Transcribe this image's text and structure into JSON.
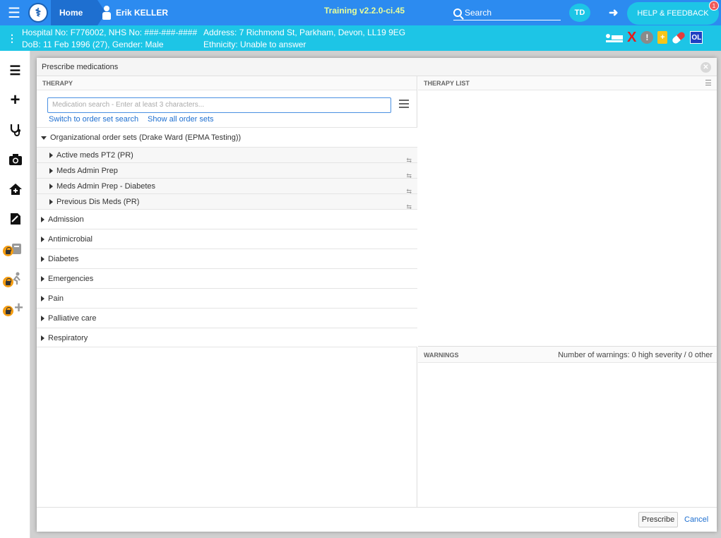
{
  "topbar": {
    "home_label": "Home",
    "patient_name": "Erik KELLER",
    "version": "Training v2.2.0-ci.45",
    "search_label": "Search",
    "avatar_initials": "TD",
    "help_label": "HELP & FEEDBACK",
    "help_badge": "1"
  },
  "patient": {
    "hospital_line": "Hospital No: F776002, NHS No: ###-###-####",
    "dob_line": "DoB: 11 Feb 1996 (27), Gender: Male",
    "address_line": "Address: 7 Richmond St, Parkham, Devon, LL19 9EG",
    "ethnicity_line": "Ethnicity: Unable to answer",
    "ol_badge": "OL"
  },
  "dialog": {
    "title": "Prescribe medications",
    "therapy_header": "THERAPY",
    "therapy_list_header": "THERAPY LIST",
    "warnings_header": "WARNINGS",
    "warnings_count": "Number of warnings: 0 high severity / 0 other",
    "search_placeholder": "Medication search - Enter at least 3 characters...",
    "switch_link": "Switch to order set search",
    "show_all_link": "Show all order sets",
    "org_group": "Organizational order sets (Drake Ward (EPMA Testing))",
    "org_items": [
      "Active meds PT2 (PR)",
      "Meds Admin Prep",
      "Meds Admin Prep - Diabetes",
      "Previous Dis Meds (PR)"
    ],
    "groups": [
      "Admission",
      "Antimicrobial",
      "Diabetes",
      "Emergencies",
      "Pain",
      "Palliative care",
      "Respiratory"
    ],
    "prescribe_label": "Prescribe",
    "cancel_label": "Cancel"
  },
  "colors": {
    "topbar": "#2c8bf0",
    "patientbar": "#1dc5e6",
    "link": "#1e6fd0"
  }
}
